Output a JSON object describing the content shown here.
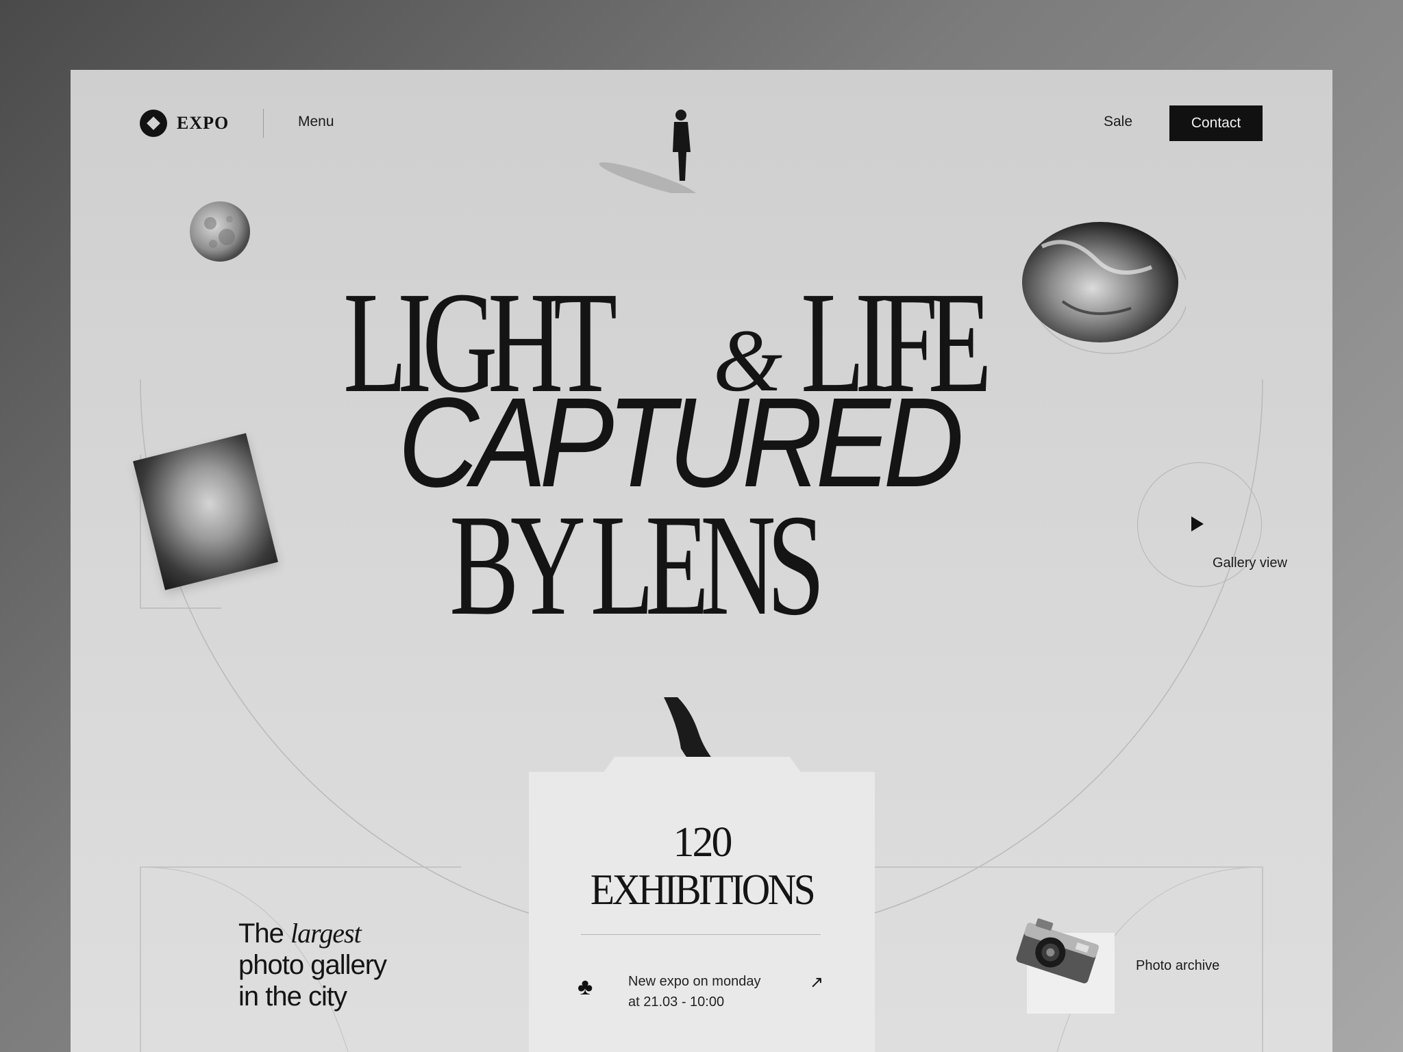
{
  "header": {
    "logo_text": "EXPO",
    "menu_label": "Menu",
    "sale_label": "Sale",
    "contact_label": "Contact"
  },
  "hero": {
    "line1_left": "LIGHT",
    "ampersand": "&",
    "line1_right": "LIFE",
    "line2": "CAPTURED",
    "line3": "BY LENS"
  },
  "gallery": {
    "label": "Gallery view",
    "icon": "play-icon"
  },
  "stats": {
    "number": "120",
    "label": "EXHIBITIONS",
    "expo_line1": "New expo on monday",
    "expo_line2": "at 21.03 - 10:00",
    "icon": "club-icon",
    "link_icon": "arrow-up-right-icon"
  },
  "tagline": {
    "part1": "The ",
    "emphasis": "largest",
    "line2": "photo gallery",
    "line3": "in the city"
  },
  "archive": {
    "label": "Photo archive"
  },
  "colors": {
    "page_bg": "#d3d3d3",
    "ink": "#121212",
    "button_bg": "#111111",
    "card_bg": "#e9e9e9"
  }
}
